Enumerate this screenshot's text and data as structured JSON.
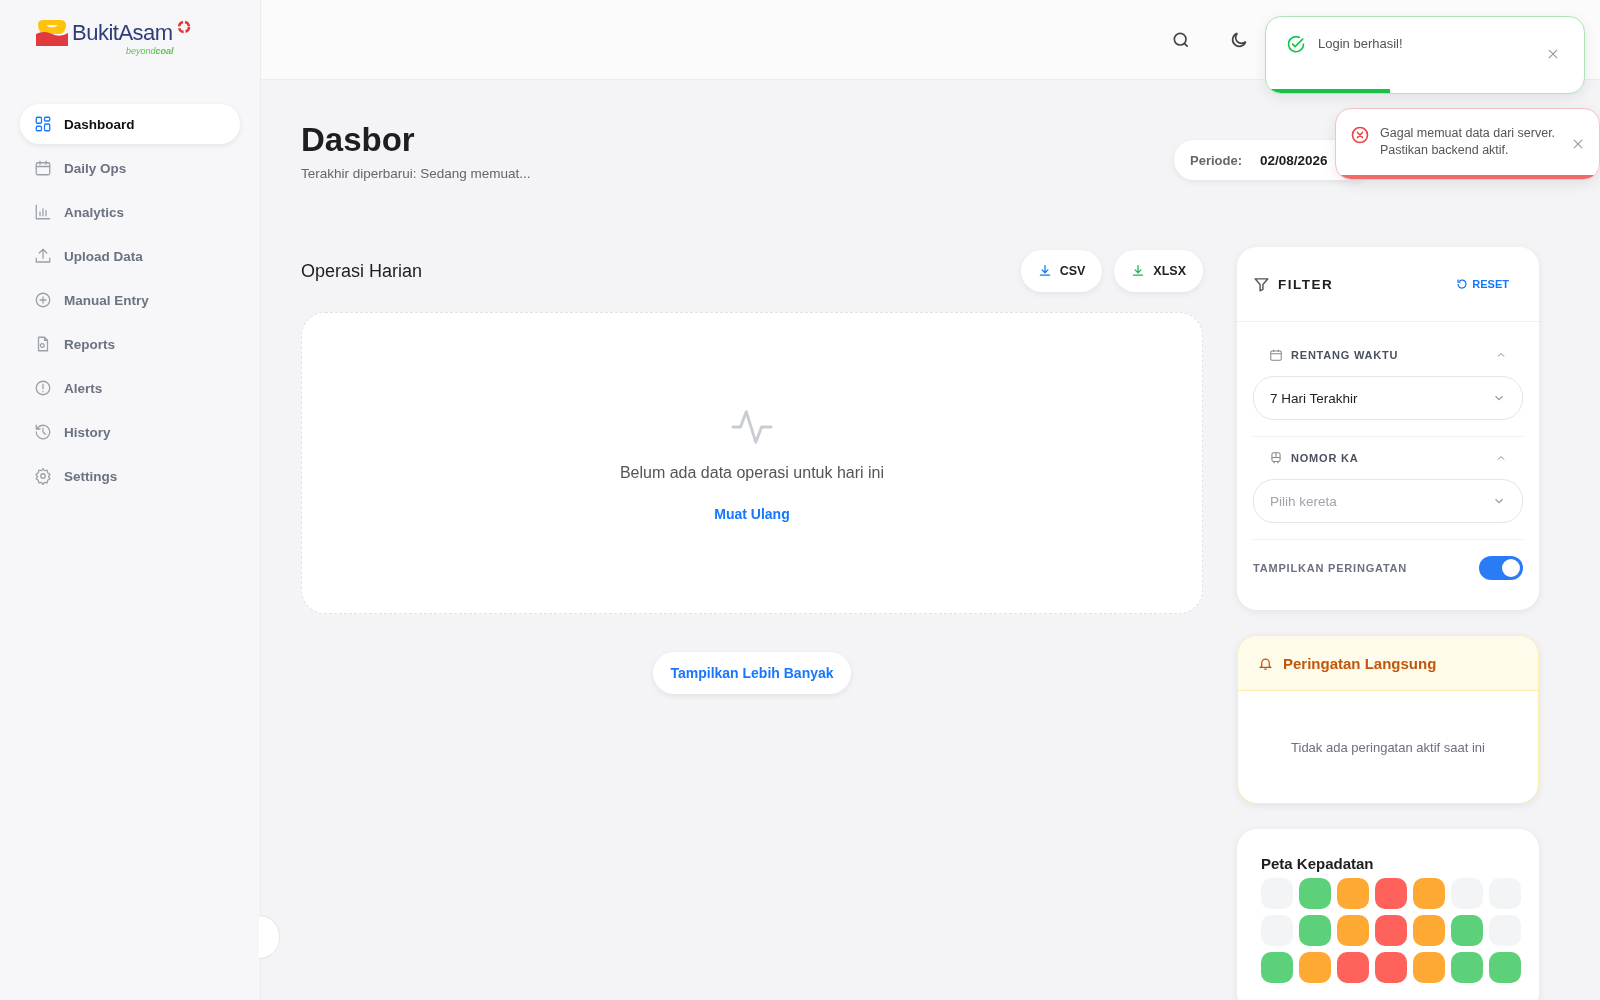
{
  "logo": {
    "name": "BukitAsam",
    "tagline": "beyond**coal**"
  },
  "sidebar": {
    "items": [
      {
        "label": "Dashboard",
        "kind": "dashboard",
        "selected": true
      },
      {
        "label": "Daily Ops",
        "kind": "calendar",
        "selected": false
      },
      {
        "label": "Analytics",
        "kind": "chart",
        "selected": false
      },
      {
        "label": "Upload Data",
        "kind": "upload",
        "selected": false
      },
      {
        "label": "Manual Entry",
        "kind": "plus",
        "selected": false
      },
      {
        "label": "Reports",
        "kind": "report",
        "selected": false
      },
      {
        "label": "Alerts",
        "kind": "alert",
        "selected": false
      },
      {
        "label": "History",
        "kind": "history",
        "selected": false
      },
      {
        "label": "Settings",
        "kind": "settings",
        "selected": false
      }
    ]
  },
  "toasts": [
    {
      "kind": "success",
      "message": "Login berhasil!",
      "level": 0.39
    },
    {
      "kind": "error",
      "message": "Gagal memuat data dari server. Pastikan backend aktif.",
      "level": 1
    }
  ],
  "page": {
    "title": "Dasbor",
    "subtitle": "Terakhir diperbarui: Sedang memuat...",
    "period_label": "Periode:",
    "period_value": "02/08/2026"
  },
  "section": {
    "title": "Operasi Harian",
    "exports": [
      {
        "label": "CSV",
        "kind": "csv"
      },
      {
        "label": "XLSX",
        "kind": "xlsx"
      }
    ],
    "empty_message": "Belum ada data operasi untuk hari ini",
    "reload": "Muat Ulang",
    "more_button": "Tampilkan Lebih Banyak"
  },
  "filter": {
    "title": "FILTER",
    "reset": "RESET",
    "groups": [
      {
        "kind": "calendar",
        "label": "RENTANG WAKTU",
        "expanded": true,
        "value": "7 Hari Terakhir"
      },
      {
        "kind": "train",
        "label": "NOMOR KA",
        "expanded": true,
        "placeholder": "Pilih kereta"
      }
    ],
    "toggle": {
      "label": "TAMPILKAN PERINGATAN",
      "on": true
    }
  },
  "alerts": {
    "title": "Peringatan Langsung",
    "empty_message": "Tidak ada peringatan aktif saat ini"
  },
  "heatmap": {
    "title": "Peta Kepadatan",
    "rows": [
      [
        {
          "color": "#f3f4f6"
        },
        {
          "color": "#5cd17a"
        },
        {
          "color": "#ffa935"
        },
        {
          "color": "#ff625a"
        },
        {
          "color": "#ffa935"
        },
        {
          "color": "#f3f4f6"
        },
        {
          "color": "#f3f4f6"
        }
      ],
      [
        {
          "color": "#f3f4f6"
        },
        {
          "color": "#5cd17a"
        },
        {
          "color": "#ffa935"
        },
        {
          "color": "#ff625a"
        },
        {
          "color": "#ffa935"
        },
        {
          "color": "#5cd17a"
        },
        {
          "color": "#f3f4f6"
        }
      ],
      [
        {
          "color": "#5cd17a"
        },
        {
          "color": "#ffa935"
        },
        {
          "color": "#ff625a"
        },
        {
          "color": "#ff625a"
        },
        {
          "color": "#ffa935"
        },
        {
          "color": "#5cd17a"
        },
        {
          "color": "#5cd17a"
        }
      ]
    ]
  }
}
